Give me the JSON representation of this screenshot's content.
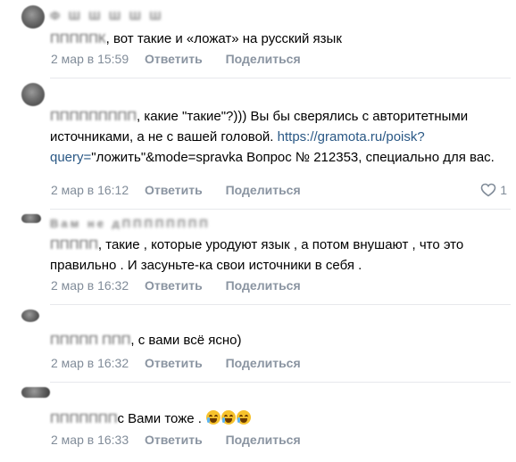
{
  "actions": {
    "reply": "Ответить",
    "share": "Поделиться"
  },
  "comments": [
    {
      "author": "Ф Ш Ш Ш Ш Ш",
      "reply_to": "ПППППК",
      "text": ", вот такие и «ложат» на русский язык",
      "date": "2 мар в 15:59"
    },
    {
      "author": "",
      "reply_to": "ППППППППП",
      "text_before_link": ", какие \"такие\"?))) Вы бы сверялись с авторитетными источниками, а не с вашей головой. ",
      "link": "https://gramota.ru/poisk?query=",
      "text_after_link": "\"ложить\"&mode=spravka Вопрос № 212353, специально для вас.",
      "date": "2 мар в 16:12",
      "likes": "1"
    },
    {
      "author": "Вам не дПППППППП",
      "reply_to": "ППППП",
      "text": ", такие , которые уродуют язык , а потом внушают , что это правильно . И засуньте-ка свои источники в себя .",
      "date": "2 мар в 16:32"
    },
    {
      "author": "",
      "reply_to": "ППППП ППП",
      "text": ", с вами всё ясно)",
      "date": "2 мар в 16:32"
    },
    {
      "author": "",
      "reply_to": "ППППППП",
      "text": "с Вами тоже .",
      "date": "2 мар в 16:33"
    }
  ]
}
